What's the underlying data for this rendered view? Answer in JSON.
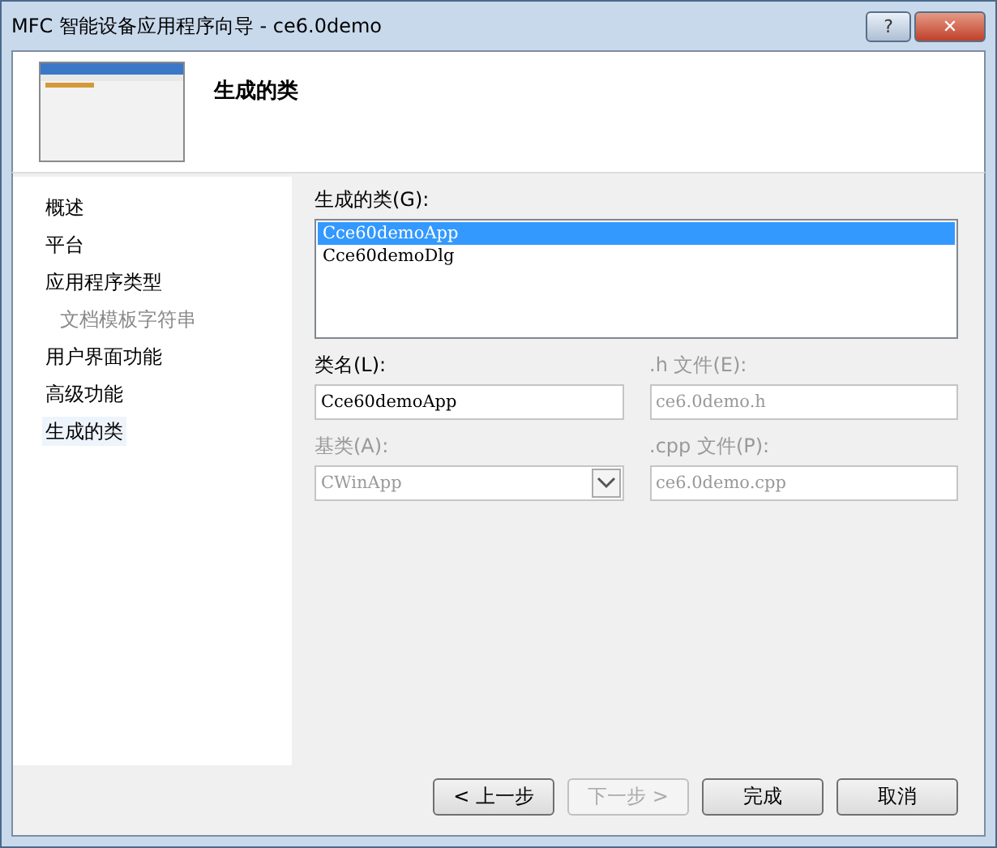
{
  "window": {
    "title": "MFC 智能设备应用程序向导 - ce6.0demo",
    "help_button": "?",
    "close_button": "✕"
  },
  "header": {
    "title": "生成的类"
  },
  "nav": [
    {
      "label": "概述",
      "selected": false,
      "disabled": false
    },
    {
      "label": "平台",
      "selected": false,
      "disabled": false
    },
    {
      "label": "应用程序类型",
      "selected": false,
      "disabled": false,
      "children": [
        {
          "label": "文档模板字符串",
          "selected": false,
          "disabled": true
        }
      ]
    },
    {
      "label": "用户界面功能",
      "selected": false,
      "disabled": false
    },
    {
      "label": "高级功能",
      "selected": false,
      "disabled": false
    },
    {
      "label": "生成的类",
      "selected": true,
      "disabled": false
    }
  ],
  "classes": {
    "label": "生成的类(G):",
    "items": [
      {
        "label": "Cce60demoApp",
        "selected": true
      },
      {
        "label": "Cce60demoDlg",
        "selected": false
      }
    ]
  },
  "fields": [
    {
      "kind": "text",
      "label": "类名(L):",
      "value": "Cce60demoApp",
      "disabled": false
    },
    {
      "kind": "text",
      "label": ".h 文件(E):",
      "value": "ce6.0demo.h",
      "disabled": true
    },
    {
      "kind": "combo",
      "label": "基类(A):",
      "value": "CWinApp",
      "disabled": true
    },
    {
      "kind": "text",
      "label": ".cpp 文件(P):",
      "value": "ce6.0demo.cpp",
      "disabled": true
    }
  ],
  "buttons": [
    {
      "label": "< 上一步",
      "disabled": false
    },
    {
      "label": "下一步 >",
      "disabled": true
    },
    {
      "label": "完成",
      "disabled": false
    },
    {
      "label": "取消",
      "disabled": false
    }
  ]
}
